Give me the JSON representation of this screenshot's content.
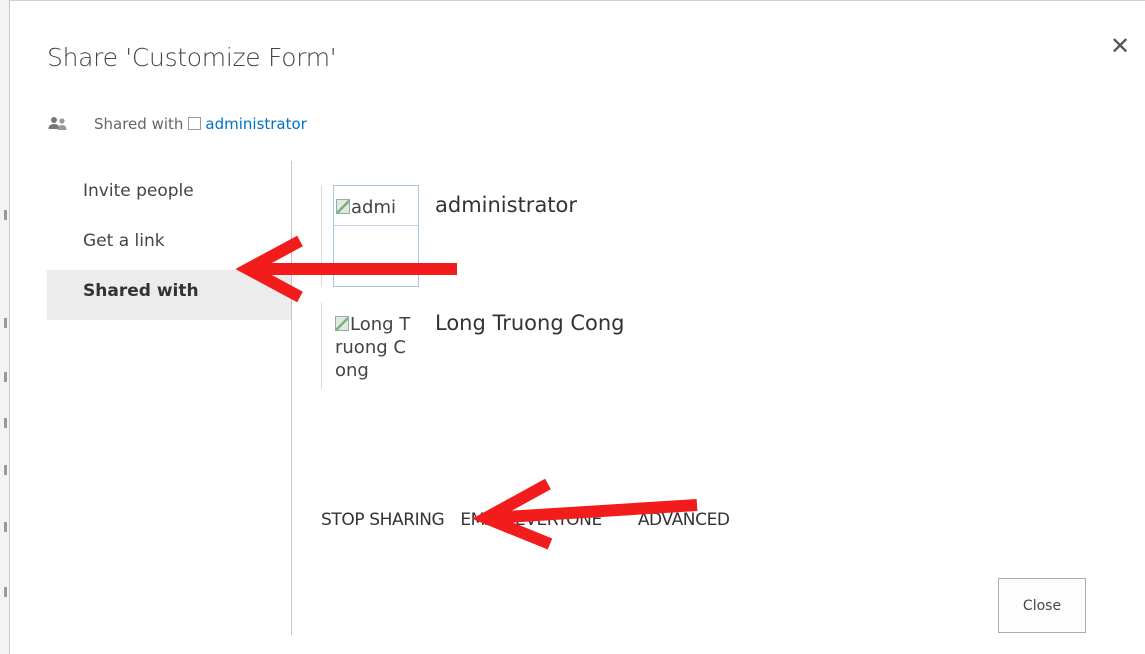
{
  "dialog": {
    "title": "Share 'Customize Form'",
    "close_glyph": "✕"
  },
  "shared_with": {
    "label": "Shared with",
    "user": "administrator",
    "icon": "people-icon"
  },
  "nav": {
    "items": [
      {
        "label": "Invite people",
        "selected": false
      },
      {
        "label": "Get a link",
        "selected": false
      },
      {
        "label": "Shared with",
        "selected": true
      }
    ]
  },
  "people": [
    {
      "name": "administrator",
      "avatar_alt": "admi"
    },
    {
      "name": "Long Truong Cong",
      "avatar_alt": "Long Truong Cong"
    }
  ],
  "actions": {
    "stop_sharing": "STOP SHARING",
    "email_everyone": "EMAIL EVERYONE",
    "advanced": "ADVANCED"
  },
  "buttons": {
    "close": "Close"
  },
  "annotations": {
    "arrow_color": "#f21c1c"
  }
}
